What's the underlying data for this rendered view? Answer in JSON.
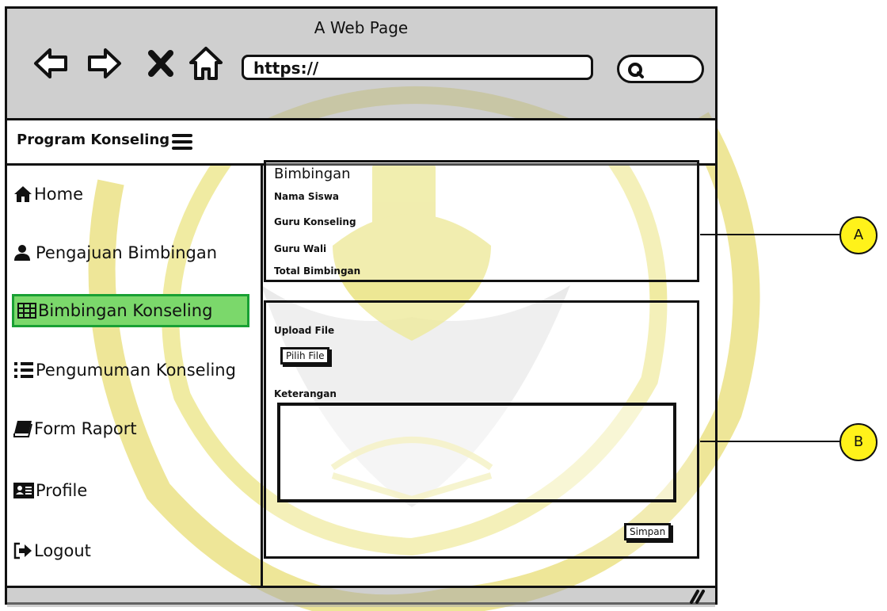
{
  "browser": {
    "title": "A Web Page",
    "url": "https://",
    "icons": [
      "back-arrow-icon",
      "forward-arrow-icon",
      "close-x-icon",
      "home-icon",
      "search-icon"
    ]
  },
  "app": {
    "brand": "Program Konseling"
  },
  "sidebar": {
    "items": [
      {
        "label": "Home",
        "icon": "home-icon"
      },
      {
        "label": "Pengajuan Bimbingan",
        "icon": "user-icon"
      },
      {
        "label": "Bimbingan Konseling",
        "icon": "table-icon",
        "active": true
      },
      {
        "label": "Pengumuman Konseling",
        "icon": "list-icon"
      },
      {
        "label": "Form Raport",
        "icon": "book-icon"
      },
      {
        "label": "Profile",
        "icon": "id-card-icon"
      },
      {
        "label": "Logout",
        "icon": "logout-icon"
      }
    ]
  },
  "panelA": {
    "title": "Bimbingan",
    "fields": [
      "Nama Siswa",
      "Guru Konseling",
      "Guru Wali",
      "Total Bimbingan"
    ]
  },
  "panelB": {
    "upload_label": "Upload File",
    "choose_file_label": "Pilih File",
    "keterangan_label": "Keterangan",
    "save_label": "Simpan"
  },
  "annotations": {
    "a": "A",
    "b": "B"
  },
  "colors": {
    "active_bg": "#7bd86b",
    "active_border": "#19a034",
    "callout_fill": "#fff21a",
    "chrome_gray": "#a8a8a8",
    "watermark": "#e9e27a"
  }
}
